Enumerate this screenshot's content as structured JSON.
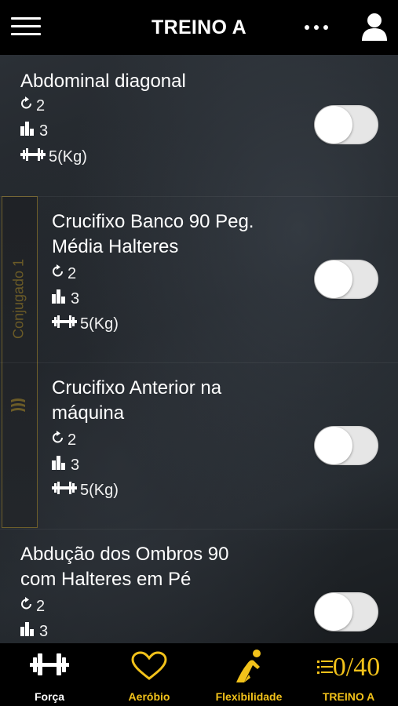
{
  "header": {
    "title": "TREINO A",
    "menu_icon": "hamburger-menu-icon",
    "more_icon": "more-dots-icon",
    "user_icon": "user-profile-icon"
  },
  "exercises": [
    {
      "name_lines": [
        "Abdominal diagonal"
      ],
      "series": "2",
      "reps": "3",
      "weight": "5(Kg)",
      "done": false
    },
    {
      "name_lines": [
        "Crucifixo Banco 90 Peg.",
        "Média Halteres"
      ],
      "series": "2",
      "reps": "3",
      "weight": "5(Kg)",
      "done": false
    },
    {
      "name_lines": [
        "Crucifixo Anterior na",
        "máquina"
      ],
      "series": "2",
      "reps": "3",
      "weight": "5(Kg)",
      "done": false
    },
    {
      "name_lines": [
        "Abdução dos Ombros 90",
        "com Halteres em Pé"
      ],
      "series": "2",
      "reps": "3",
      "done": false
    }
  ],
  "conjugado": {
    "label": "Conjugado 1"
  },
  "tabs": [
    {
      "label": "Força",
      "icon": "dumbbell-icon"
    },
    {
      "label": "Aeróbio",
      "icon": "heart-icon"
    },
    {
      "label": "Flexibilidade",
      "icon": "stretching-figure-icon"
    },
    {
      "label": "TREINO A",
      "icon": "list-icon",
      "counter": "0/40"
    }
  ],
  "colors": {
    "accent": "#f2c21a",
    "topbar": "#000000",
    "toggle_off": "#e6e6e6",
    "conjugado_border": "#6e5e2a"
  }
}
